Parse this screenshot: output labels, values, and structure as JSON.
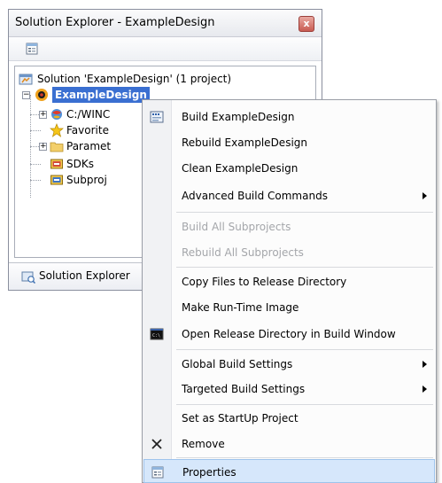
{
  "window": {
    "title": "Solution Explorer - ExampleDesign",
    "close_glyph": "x",
    "bottom_tab_label": "Solution Explorer"
  },
  "tree": {
    "solution_label": "Solution 'ExampleDesign' (1 project)",
    "project_label": "ExampleDesign",
    "children": [
      {
        "label": "C:/WINC",
        "icon": "os-design-icon",
        "expandable": true
      },
      {
        "label": "Favorite",
        "icon": "favorites-star-icon",
        "expandable": false
      },
      {
        "label": "Paramet",
        "icon": "folder-icon",
        "expandable": true
      },
      {
        "label": "SDKs",
        "icon": "sdk-icon",
        "expandable": false
      },
      {
        "label": "Subproj",
        "icon": "subproject-icon",
        "expandable": false
      }
    ]
  },
  "context_menu": {
    "items": [
      {
        "label": "Build ExampleDesign",
        "icon": "build-icon",
        "disabled": false,
        "submenu": false
      },
      {
        "label": "Rebuild ExampleDesign",
        "disabled": false,
        "submenu": false
      },
      {
        "label": "Clean ExampleDesign",
        "disabled": false,
        "submenu": false
      },
      {
        "label": "Advanced Build Commands",
        "disabled": false,
        "submenu": true
      },
      {
        "label": "Build All Subprojects",
        "disabled": true,
        "submenu": false
      },
      {
        "label": "Rebuild All Subprojects",
        "disabled": true,
        "submenu": false
      },
      {
        "label": "Copy Files to Release Directory",
        "disabled": false,
        "submenu": false
      },
      {
        "label": "Make Run-Time Image",
        "disabled": false,
        "submenu": false
      },
      {
        "label": "Open Release Directory in Build Window",
        "icon": "console-icon",
        "disabled": false,
        "submenu": false
      },
      {
        "label": "Global Build Settings",
        "disabled": false,
        "submenu": true
      },
      {
        "label": "Targeted Build Settings",
        "disabled": false,
        "submenu": true
      },
      {
        "label": "Set as StartUp Project",
        "disabled": false,
        "submenu": false
      },
      {
        "label": "Remove",
        "icon": "remove-x-icon",
        "disabled": false,
        "submenu": false
      },
      {
        "label": "Properties",
        "icon": "properties-icon",
        "disabled": false,
        "submenu": false,
        "highlighted": true
      }
    ]
  },
  "colors": {
    "selection": "#3a6fd1",
    "menu_highlight": "#d6e7fb",
    "disabled_text": "#a4a6aa"
  }
}
